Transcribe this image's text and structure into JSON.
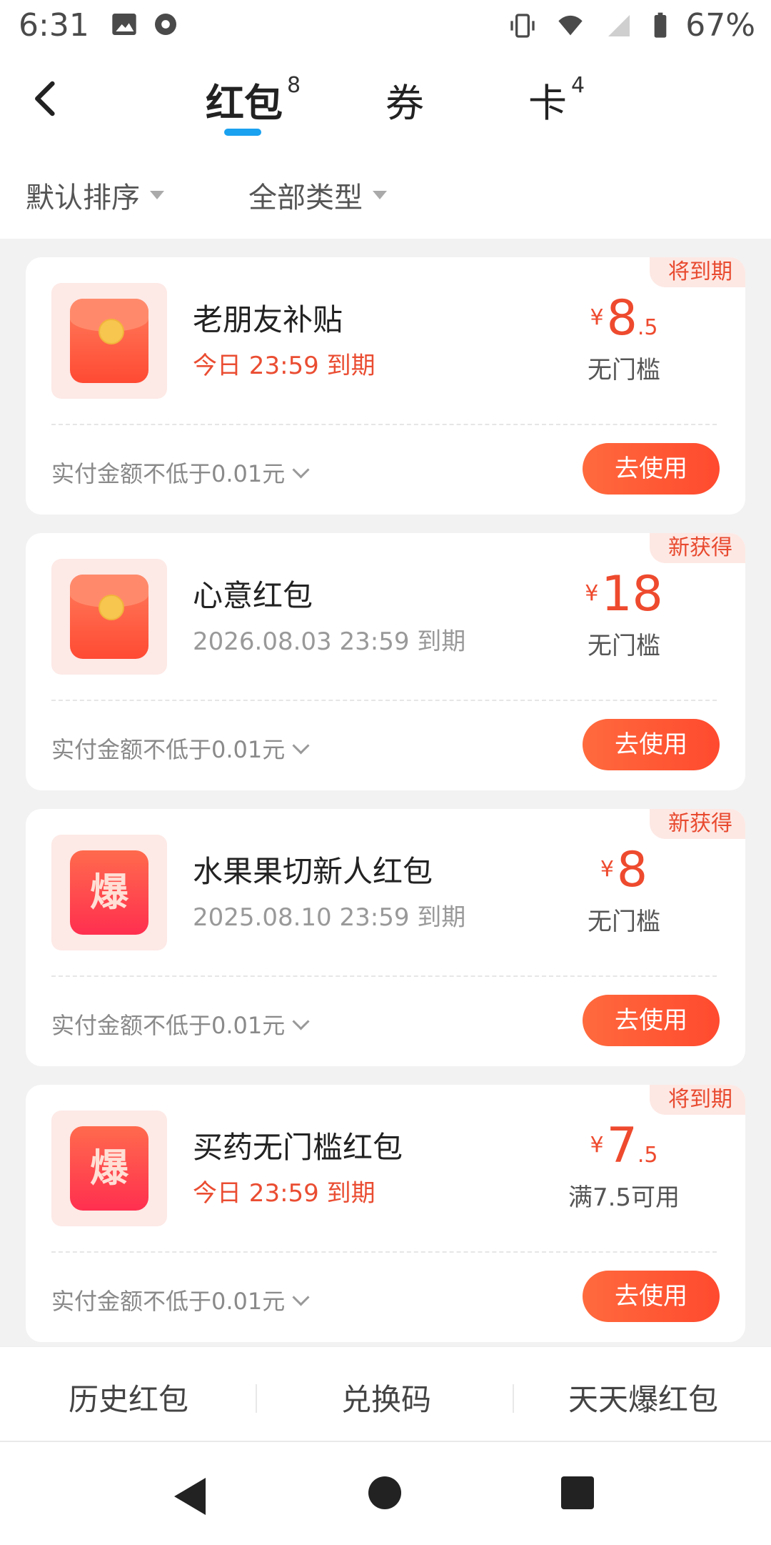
{
  "status": {
    "time": "6:31",
    "battery": "67%"
  },
  "header": {
    "tabs": [
      {
        "label": "红包",
        "count": "8",
        "active": true
      },
      {
        "label": "券",
        "count": "",
        "active": false
      },
      {
        "label": "卡",
        "count": "4",
        "active": false
      }
    ]
  },
  "filters": {
    "sort": "默认排序",
    "type": "全部类型"
  },
  "cards": [
    {
      "badge": "将到期",
      "icon": "red-envelope",
      "title": "老朋友补贴",
      "expire": "今日 23:59 到期",
      "expire_urgent": true,
      "yen": "¥",
      "int": "8",
      "dec": ".5",
      "threshold": "无门槛",
      "note": "实付金额不低于0.01元",
      "button": "去使用"
    },
    {
      "badge": "新获得",
      "icon": "red-envelope",
      "title": "心意红包",
      "expire": "2026.08.03 23:59 到期",
      "expire_urgent": false,
      "yen": "¥",
      "int": "18",
      "dec": "",
      "threshold": "无门槛",
      "note": "实付金额不低于0.01元",
      "button": "去使用"
    },
    {
      "badge": "新获得",
      "icon": "boom",
      "icon_text": "爆",
      "title": "水果果切新人红包",
      "expire": "2025.08.10 23:59 到期",
      "expire_urgent": false,
      "yen": "¥",
      "int": "8",
      "dec": "",
      "threshold": "无门槛",
      "note": "实付金额不低于0.01元",
      "button": "去使用"
    },
    {
      "badge": "将到期",
      "icon": "boom",
      "icon_text": "爆",
      "title": "买药无门槛红包",
      "expire": "今日 23:59 到期",
      "expire_urgent": true,
      "yen": "¥",
      "int": "7",
      "dec": ".5",
      "threshold": "满7.5可用",
      "note": "实付金额不低于0.01元",
      "button": "去使用"
    }
  ],
  "bottom": {
    "history": "历史红包",
    "redeem": "兑换码",
    "daily": "天天爆红包"
  },
  "colors": {
    "accent": "#1aa1f0",
    "red": "#ee4a2e"
  }
}
